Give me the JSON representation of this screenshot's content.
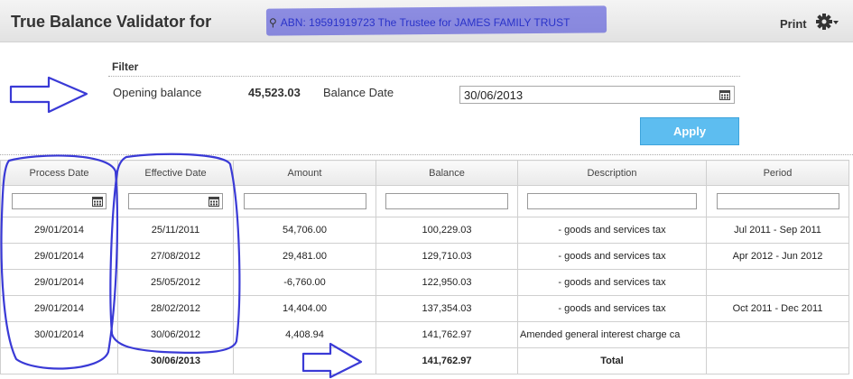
{
  "header": {
    "title": "True Balance Validator for",
    "entity": "ABN: 19591919723 The Trustee for JAMES FAMILY TRUST",
    "print_label": "Print"
  },
  "filter": {
    "heading": "Filter",
    "opening_balance_label": "Opening balance",
    "opening_balance_value": "45,523.03",
    "balance_date_label": "Balance Date",
    "balance_date_value": "30/06/2013",
    "apply_label": "Apply"
  },
  "grid": {
    "columns": [
      "Process Date",
      "Effective Date",
      "Amount",
      "Balance",
      "Description",
      "Period"
    ],
    "rows": [
      [
        "29/01/2014",
        "25/11/2011",
        "54,706.00",
        "100,229.03",
        "- goods and services tax",
        "Jul 2011 - Sep 2011"
      ],
      [
        "29/01/2014",
        "27/08/2012",
        "29,481.00",
        "129,710.03",
        "- goods and services tax",
        "Apr 2012 - Jun 2012"
      ],
      [
        "29/01/2014",
        "25/05/2012",
        "-6,760.00",
        "122,950.03",
        "- goods and services tax",
        ""
      ],
      [
        "29/01/2014",
        "28/02/2012",
        "14,404.00",
        "137,354.03",
        "- goods and services tax",
        "Oct 2011 - Dec 2011"
      ],
      [
        "30/01/2014",
        "30/06/2012",
        "4,408.94",
        "141,762.97",
        "Amended general interest charge ca",
        ""
      ]
    ],
    "total": {
      "effective_date": "30/06/2013",
      "balance": "141,762.97",
      "label": "Total"
    }
  },
  "colors": {
    "apply_button": "#5dbdf0",
    "annotation": "#3a3ad6"
  }
}
